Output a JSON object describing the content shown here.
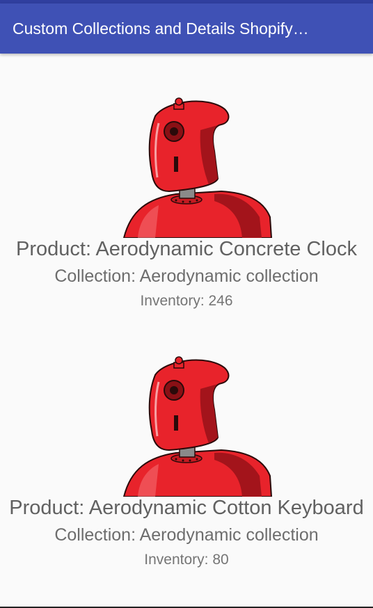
{
  "app_bar": {
    "title": "Custom Collections and Details Shopify…",
    "color": "#3f51b5"
  },
  "products": [
    {
      "image_icon": "robot-icon",
      "product": "Product: Aerodynamic Concrete Clock",
      "collection": "Collection: Aerodynamic collection",
      "inventory": "Inventory: 246"
    },
    {
      "image_icon": "robot-icon",
      "product": "Product: Aerodynamic Cotton Keyboard",
      "collection": "Collection: Aerodynamic collection",
      "inventory": "Inventory: 80"
    }
  ],
  "colors": {
    "robot_red": "#e8232b",
    "robot_dark": "#a3141b",
    "text_gray": "#616161"
  }
}
